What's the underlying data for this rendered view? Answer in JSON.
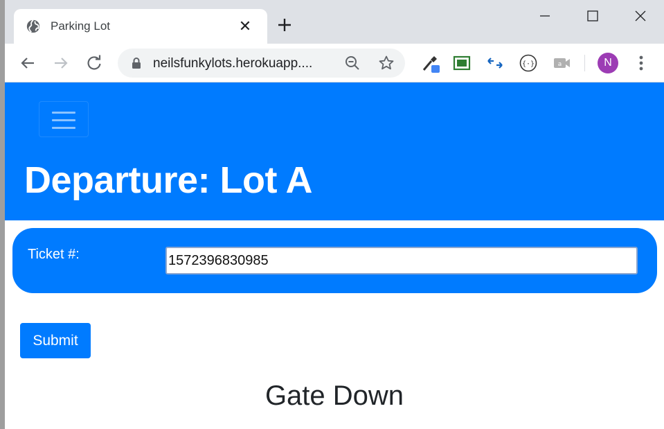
{
  "browser": {
    "tab": {
      "title": "Parking Lot",
      "favicon": "globe-icon",
      "close": "✕"
    },
    "new_tab": "plus-icon",
    "window_controls": [
      "minimize-icon",
      "maximize-icon",
      "close-icon"
    ],
    "toolbar": {
      "url": "neilsfunkylots.herokuapp....",
      "extensions": [
        "eyedropper-icon",
        "screenshot-icon",
        "arrows-icon",
        "json-icon",
        "camera-icon"
      ],
      "profile_initial": "N",
      "profile_color": "#9c3cb4"
    }
  },
  "page": {
    "heading": "Departure: Lot A",
    "ticket_label": "Ticket #:",
    "ticket_value": "1572396830985",
    "submit_label": "Submit",
    "status": "Gate Down",
    "accent_color": "#007bff"
  }
}
